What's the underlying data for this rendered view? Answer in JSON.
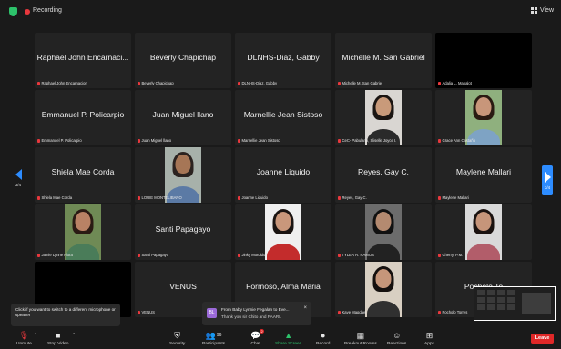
{
  "topbar": {
    "recording_label": "Recording",
    "view_label": "View"
  },
  "pagination": {
    "left_label": "3/4",
    "right_label": "3/4"
  },
  "tiles": [
    {
      "big": "Raphael John Encarnaci...",
      "name": "Raphael John Encarnacion",
      "type": "text"
    },
    {
      "big": "Beverly Chapichap",
      "name": "Beverly Chapichap",
      "type": "text"
    },
    {
      "big": "DLNHS-Diaz, Gabby",
      "name": "DLNHS-Diaz, Gabby",
      "type": "text"
    },
    {
      "big": "Michelle  M. San Gabriel",
      "name": "Michelle  M. San Gabriel",
      "type": "text"
    },
    {
      "big": "",
      "name": "Adalia L. Mabalot",
      "type": "black"
    },
    {
      "big": "Emmanuel P. Policarpio",
      "name": "Emmanuel P. Policarpio",
      "type": "text"
    },
    {
      "big": "Juan Miguel llano",
      "name": "Juan Miguel llano",
      "type": "text"
    },
    {
      "big": "Marnellie Jean Sistoso",
      "name": "Marnellie Jean Sistoso",
      "type": "text"
    },
    {
      "big": "",
      "name": "CeC- Pabulario, Sliselle Joyce I.",
      "type": "photo",
      "bg": "#d9d6d2",
      "skin": "#c99a7a",
      "hair": "#1b1512",
      "shirt": "#2a2a2a"
    },
    {
      "big": "",
      "name": "Grace Ann Castaño",
      "type": "photo",
      "bg": "#8fb07e",
      "skin": "#c8967a",
      "hair": "#2a1a12",
      "shirt": "#7ea3c4"
    },
    {
      "big": "Shiela Mae Corda",
      "name": "Shiela Mae Corda",
      "type": "text"
    },
    {
      "big": "",
      "name": "LOUIE MONTELIBANO",
      "type": "photo",
      "bg": "#a7b1aa",
      "skin": "#a67656",
      "hair": "#2b2320",
      "shirt": "#5b7aa5"
    },
    {
      "big": "Joanne Liquido",
      "name": "Joanne Liquido",
      "type": "text"
    },
    {
      "big": "Reyes, Gay C.",
      "name": "Reyes, Gay C.",
      "type": "text"
    },
    {
      "big": "Maylene Mallari",
      "name": "Maylene Mallari",
      "type": "text"
    },
    {
      "big": "",
      "name": "Jamie Lynne Flora",
      "type": "photo",
      "bg": "#6f8a55",
      "skin": "#b98265",
      "hair": "#2a1b14",
      "shirt": "#4a7c59"
    },
    {
      "big": "Santi Papagayo",
      "name": "Santi Papagayo",
      "type": "text"
    },
    {
      "big": "",
      "name": "Jinky  Mordido",
      "type": "photo",
      "bg": "#efefef",
      "skin": "#c9977b",
      "hair": "#1a1412",
      "shirt": "#c32c2c"
    },
    {
      "big": "",
      "name": "TYLER R. RAMOS",
      "type": "photo",
      "bg": "#6c6c6c",
      "skin": "#b48a70",
      "hair": "#111",
      "shirt": "#222"
    },
    {
      "big": "",
      "name": "Cherryl P.M.",
      "type": "photo",
      "bg": "#d9d9d9",
      "skin": "#c6957a",
      "hair": "#1a1210",
      "shirt": "#b25d6a"
    },
    {
      "big": "",
      "name": "",
      "type": "black"
    },
    {
      "big": "VENUS",
      "name": "VENUS",
      "type": "text"
    },
    {
      "big": "Formoso, Alma Maria",
      "name": "",
      "type": "text"
    },
    {
      "big": "",
      "name": "Kaye Magdael",
      "type": "photo",
      "bg": "#d8cfc2",
      "skin": "#c6967a",
      "hair": "#15100e",
      "shirt": "#303030"
    },
    {
      "big": "Pocholo To",
      "name": "Pocholo Torres",
      "type": "text"
    }
  ],
  "tooltip": {
    "text": "Click if you want to switch to a different microphone or speaker"
  },
  "chat_popup": {
    "avatar": "BL",
    "line1": "From Baby Lynnie Fegalan to Eve...",
    "line2": "Thank you sir Chito and PAARL"
  },
  "toolbar": {
    "unmute": "Unmute",
    "stop_video": "Stop Video",
    "security": "Security",
    "participants": "Participants",
    "participants_count": "96",
    "chat": "Chat",
    "chat_badge": "2",
    "share_screen": "Share Screen",
    "record": "Record",
    "breakout_rooms": "Breakout Rooms",
    "reactions": "Reactions",
    "apps": "Apps",
    "leave": "Leave"
  },
  "colors": {
    "accent": "#2d8cff",
    "share_green": "#2dc26b",
    "leave_red": "#e02828",
    "recording_red": "#e8383d"
  }
}
